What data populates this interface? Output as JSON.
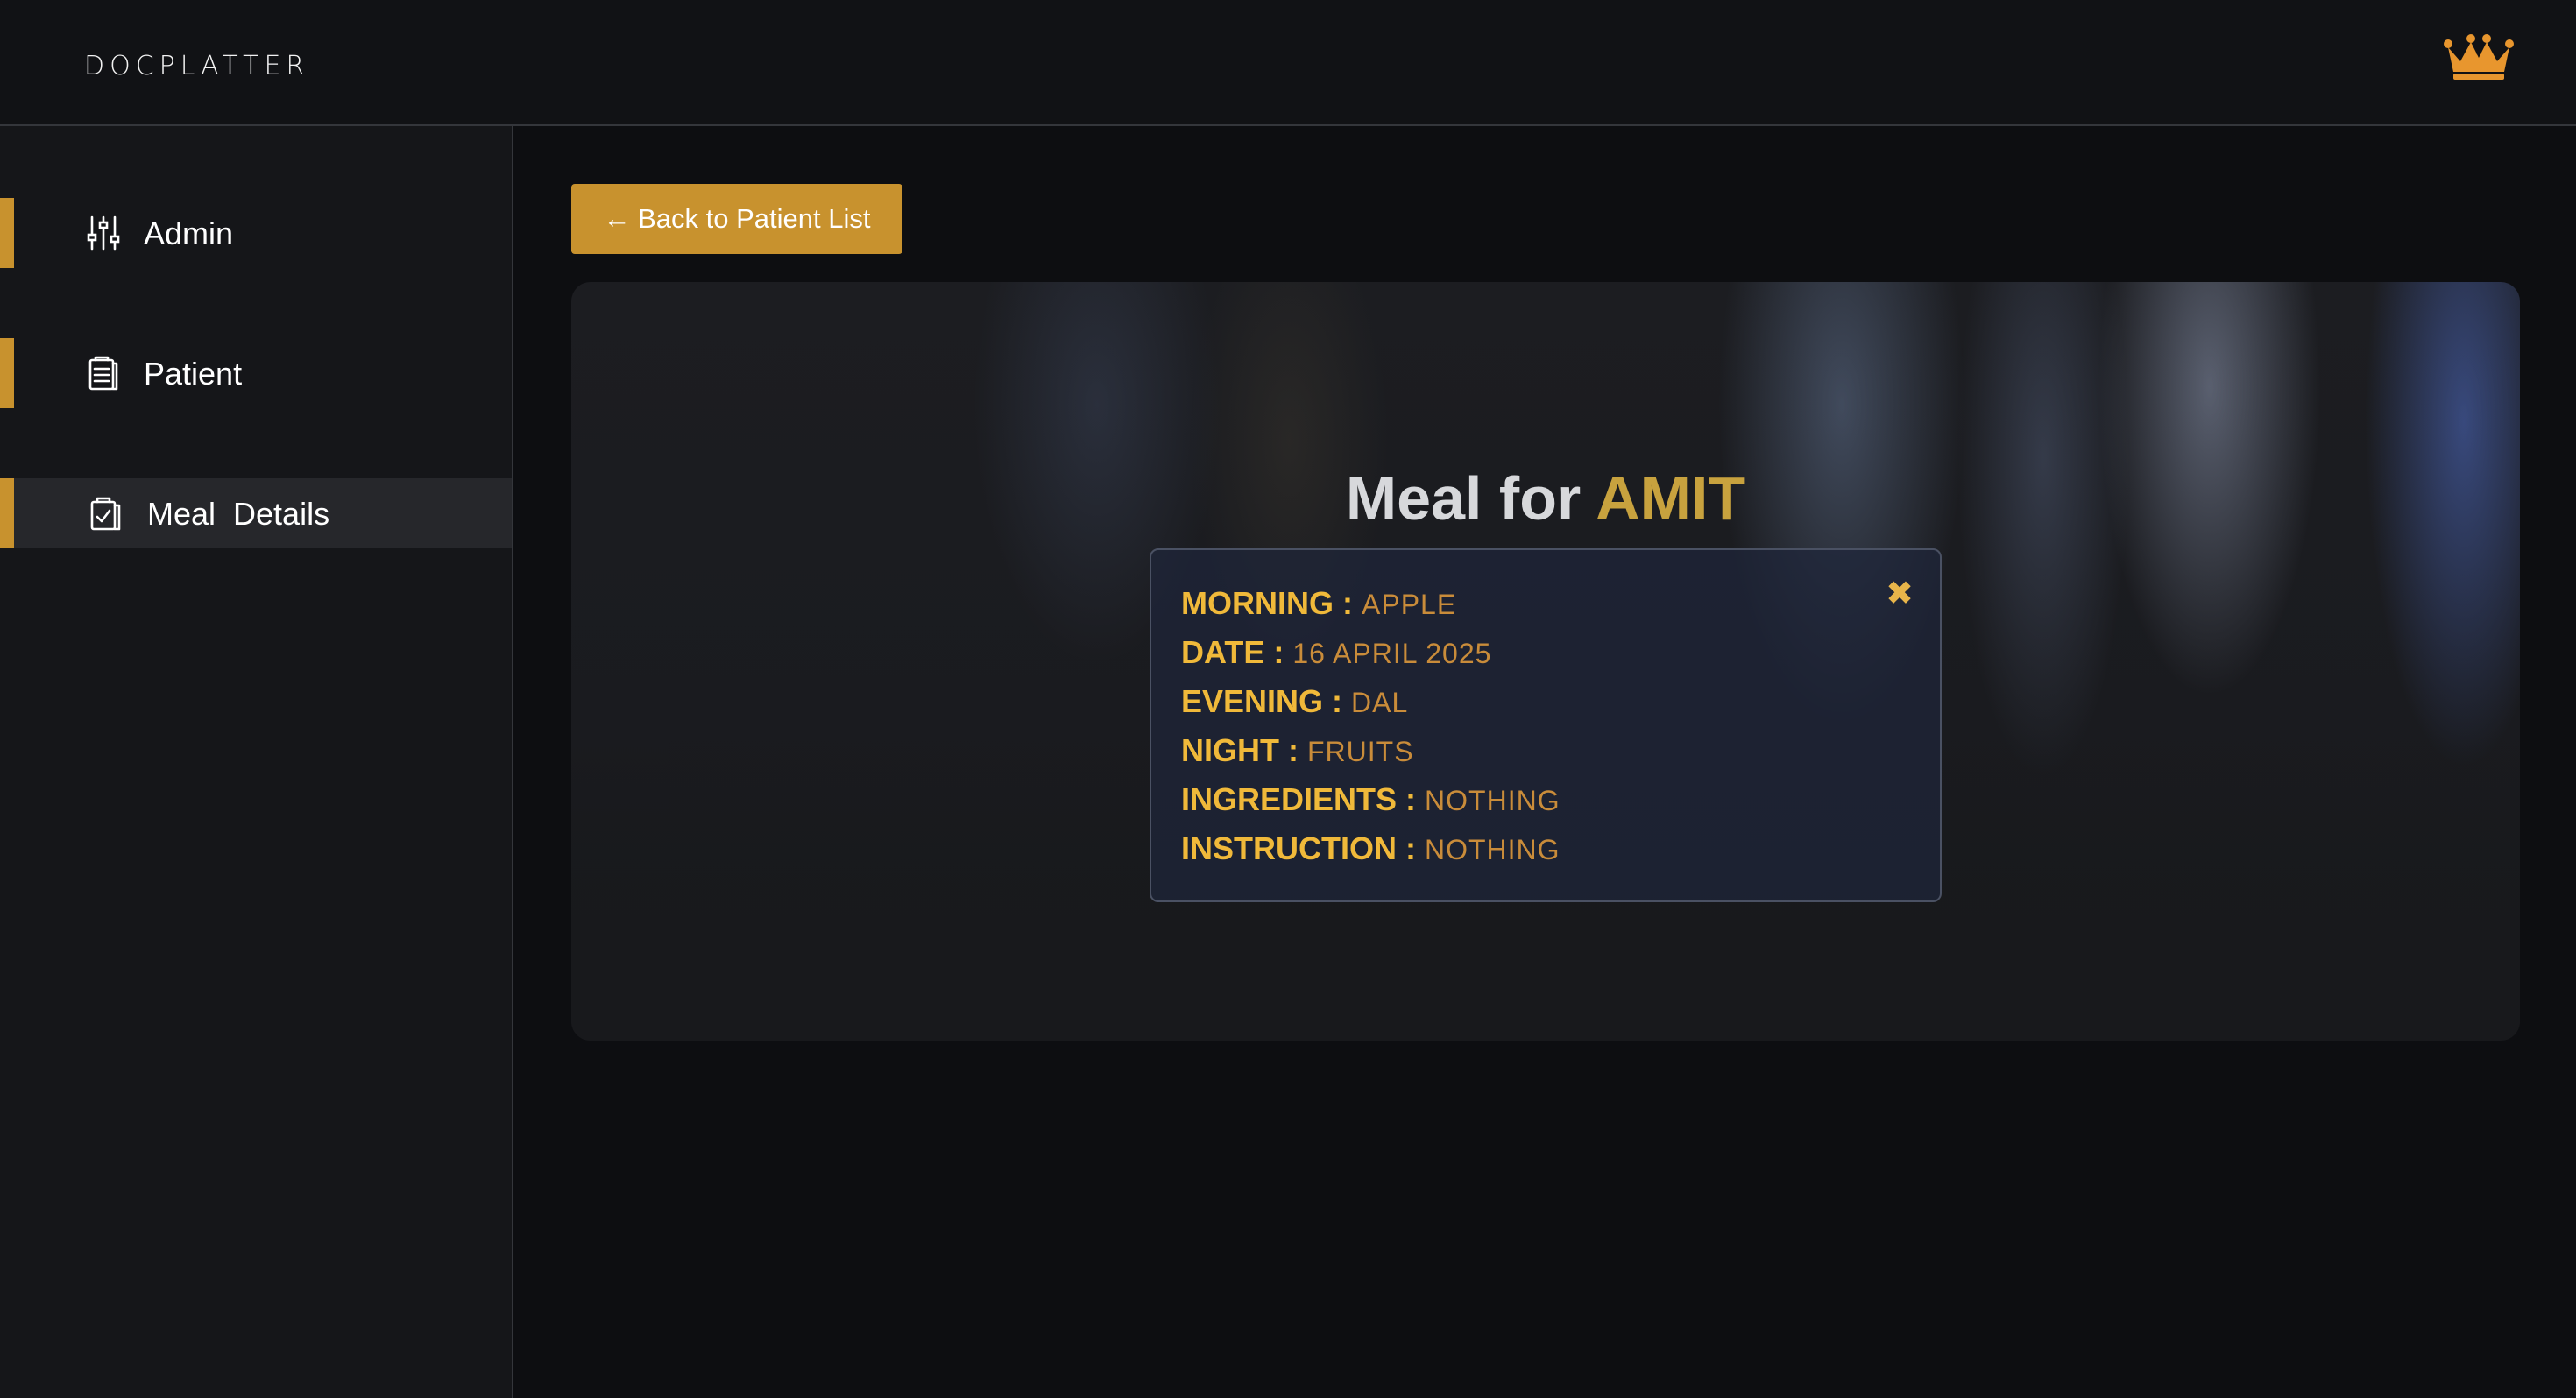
{
  "header": {
    "logo_text": "DOCPLATTER",
    "crown_icon": "crown-icon",
    "crown_color": "#e8962e"
  },
  "sidebar": {
    "accent_color": "#c8922e",
    "items": [
      {
        "label": "Admin",
        "icon": "sliders-icon",
        "active": false
      },
      {
        "label": "Patient",
        "icon": "clipboard-list-icon",
        "active": false
      },
      {
        "label": "Meal  Details",
        "icon": "clipboard-check-icon",
        "active": true
      }
    ]
  },
  "main": {
    "back_button_label": "← Back to Patient List",
    "title_prefix": "Meal for",
    "patient_name": "AMIT",
    "meal": {
      "rows": [
        {
          "key": "MORNING",
          "value": "APPLE"
        },
        {
          "key": "DATE",
          "value": "16 APRIL 2025"
        },
        {
          "key": "EVENING",
          "value": "DAL"
        },
        {
          "key": "NIGHT",
          "value": "FRUITS"
        },
        {
          "key": "INGREDIENTS",
          "value": "NOTHING"
        },
        {
          "key": "INSTRUCTION",
          "value": "NOTHING"
        }
      ],
      "separator": ":",
      "close_icon": "close-icon"
    }
  }
}
